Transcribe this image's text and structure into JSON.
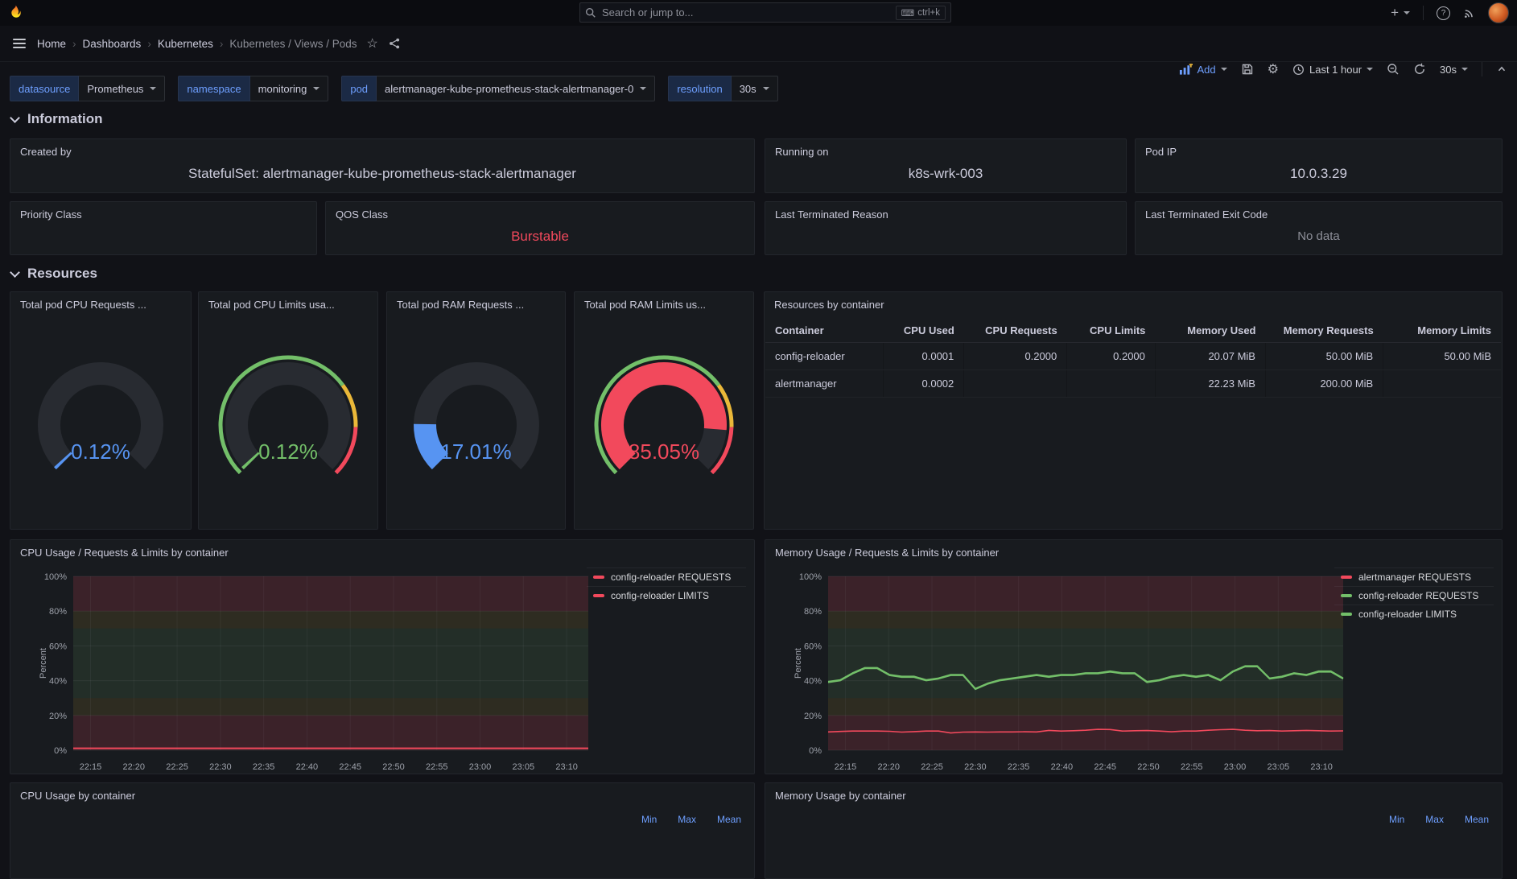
{
  "nav": {
    "search_placeholder": "Search or jump to...",
    "shortcut": "ctrl+k"
  },
  "breadcrumb": {
    "items": [
      "Home",
      "Dashboards",
      "Kubernetes",
      "Kubernetes / Views / Pods"
    ]
  },
  "toolbar": {
    "add_label": "Add",
    "time_range": "Last 1 hour",
    "refresh_interval": "30s"
  },
  "variables": {
    "items": [
      {
        "label": "datasource",
        "value": "Prometheus"
      },
      {
        "label": "namespace",
        "value": "monitoring"
      },
      {
        "label": "pod",
        "value": "alertmanager-kube-prometheus-stack-alertmanager-0"
      },
      {
        "label": "resolution",
        "value": "30s"
      }
    ]
  },
  "sections": {
    "information": "Information",
    "resources": "Resources"
  },
  "info": {
    "panels": [
      {
        "title": "Created by",
        "value": "StatefulSet: alertmanager-kube-prometheus-stack-alertmanager"
      },
      {
        "title": "Running on",
        "value": "k8s-wrk-003"
      },
      {
        "title": "Pod IP",
        "value": "10.0.3.29"
      },
      {
        "title": "Priority Class",
        "value": ""
      },
      {
        "title": "QOS Class",
        "value": "Burstable"
      },
      {
        "title": "Last Terminated Reason",
        "value": ""
      },
      {
        "title": "Last Terminated Exit Code",
        "value": "No data"
      }
    ]
  },
  "gauges": {
    "panels": [
      {
        "title": "Total pod CPU Requests ...",
        "value": 0.12,
        "label": "0.12%",
        "color": "#5794F2",
        "ring": false
      },
      {
        "title": "Total pod CPU Limits usa...",
        "value": 0.12,
        "label": "0.12%",
        "color": "#73BF69",
        "ring": true
      },
      {
        "title": "Total pod RAM Requests ...",
        "value": 17.01,
        "label": "17.01%",
        "color": "#5794F2",
        "ring": false
      },
      {
        "title": "Total pod RAM Limits us...",
        "value": 85.05,
        "label": "85.05%",
        "color": "#F2495C",
        "ring": true
      }
    ],
    "thresholds": [
      {
        "from": 0,
        "to": 70,
        "color": "#73BF69"
      },
      {
        "from": 70,
        "to": 84,
        "color": "#EAB839"
      },
      {
        "from": 84,
        "to": 100,
        "color": "#F2495C"
      }
    ]
  },
  "table": {
    "title": "Resources by container",
    "headers": [
      "Container",
      "CPU Used",
      "CPU Requests",
      "CPU Limits",
      "Memory Used",
      "Memory Requests",
      "Memory Limits"
    ],
    "rows": [
      [
        "config-reloader",
        "0.0001",
        "0.2000",
        "0.2000",
        "20.07 MiB",
        "50.00 MiB",
        "50.00 MiB"
      ],
      [
        "alertmanager",
        "0.0002",
        "",
        "",
        "22.23 MiB",
        "200.00 MiB",
        ""
      ]
    ]
  },
  "chart_data": [
    {
      "type": "line",
      "title": "CPU Usage / Requests & Limits by container",
      "ylabel": "Percent",
      "ylim": [
        0,
        100
      ],
      "yticks": [
        "0%",
        "20%",
        "40%",
        "60%",
        "80%",
        "100%"
      ],
      "xticks": [
        "22:15",
        "22:20",
        "22:25",
        "22:30",
        "22:35",
        "22:40",
        "22:45",
        "22:50",
        "22:55",
        "23:00",
        "23:05",
        "23:10"
      ],
      "legend_position": "right",
      "bands": [
        {
          "from": 0,
          "to": 20,
          "color": "rgba(242,73,92,0.16)"
        },
        {
          "from": 20,
          "to": 30,
          "color": "rgba(204,165,45,0.13)"
        },
        {
          "from": 30,
          "to": 70,
          "color": "rgba(115,191,105,0.12)"
        },
        {
          "from": 70,
          "to": 80,
          "color": "rgba(204,165,45,0.13)"
        },
        {
          "from": 80,
          "to": 100,
          "color": "rgba(242,73,92,0.16)"
        }
      ],
      "series": [
        {
          "name": "config-reloader REQUESTS",
          "color": "#F2495C",
          "values": [
            1,
            1
          ]
        },
        {
          "name": "config-reloader LIMITS",
          "color": "#F2495C",
          "values": [
            1.2,
            1.2
          ]
        }
      ]
    },
    {
      "type": "line",
      "title": "Memory Usage / Requests & Limits by container",
      "ylabel": "Percent",
      "ylim": [
        0,
        100
      ],
      "yticks": [
        "0%",
        "20%",
        "40%",
        "60%",
        "80%",
        "100%"
      ],
      "xticks": [
        "22:15",
        "22:20",
        "22:25",
        "22:30",
        "22:35",
        "22:40",
        "22:45",
        "22:50",
        "22:55",
        "23:00",
        "23:05",
        "23:10"
      ],
      "legend_position": "right",
      "bands": [
        {
          "from": 0,
          "to": 20,
          "color": "rgba(242,73,92,0.16)"
        },
        {
          "from": 20,
          "to": 30,
          "color": "rgba(204,165,45,0.13)"
        },
        {
          "from": 30,
          "to": 70,
          "color": "rgba(115,191,105,0.12)"
        },
        {
          "from": 70,
          "to": 80,
          "color": "rgba(204,165,45,0.13)"
        },
        {
          "from": 80,
          "to": 100,
          "color": "rgba(242,73,92,0.16)"
        }
      ],
      "series": [
        {
          "name": "alertmanager REQUESTS",
          "color": "#F2495C",
          "values": [
            10.5,
            10.8,
            11,
            11,
            11,
            10.9,
            10.4,
            10.7,
            11,
            11,
            9.9,
            10.4,
            10.5,
            10.4,
            10.5,
            10.5,
            10.6,
            10.5,
            11.4,
            11,
            11.2,
            11.5,
            12,
            11.9,
            11,
            11.2,
            11.3,
            11,
            10.6,
            11,
            11,
            11.5,
            11.8,
            12,
            11.5,
            11.2,
            11.3,
            11,
            11.2,
            11.4,
            11.2,
            11,
            11.1
          ]
        },
        {
          "name": "config-reloader REQUESTS",
          "color": "#73BF69",
          "values": [
            39,
            40,
            44,
            47,
            47,
            43,
            42,
            42,
            40,
            41,
            43,
            43,
            35,
            38,
            40,
            41,
            42,
            43,
            42,
            43,
            43,
            44,
            44,
            45,
            44,
            44,
            39,
            40,
            42,
            43,
            42,
            43,
            40,
            45,
            48,
            48,
            41,
            42,
            44,
            43,
            45,
            45,
            41
          ]
        },
        {
          "name": "config-reloader LIMITS",
          "color": "#73BF69",
          "values": [
            39.5,
            40.5,
            44.5,
            47.5,
            47.5,
            43.5,
            42.5,
            42.5,
            40.5,
            41.5,
            43.5,
            43.5,
            35.5,
            38.5,
            40.5,
            41.5,
            42.5,
            43.5,
            42.5,
            43.5,
            43.5,
            44.5,
            44.5,
            45.5,
            44.5,
            44.5,
            39.5,
            40.5,
            42.5,
            43.5,
            42.5,
            43.5,
            40.5,
            45.5,
            48.5,
            48.5,
            41.5,
            42.5,
            44.5,
            43.5,
            45.5,
            45.5,
            41.5
          ]
        }
      ]
    }
  ],
  "bottom": {
    "panels": [
      {
        "title": "CPU Usage by container"
      },
      {
        "title": "Memory Usage by container"
      }
    ],
    "legend_headers": [
      "Min",
      "Max",
      "Mean"
    ]
  }
}
